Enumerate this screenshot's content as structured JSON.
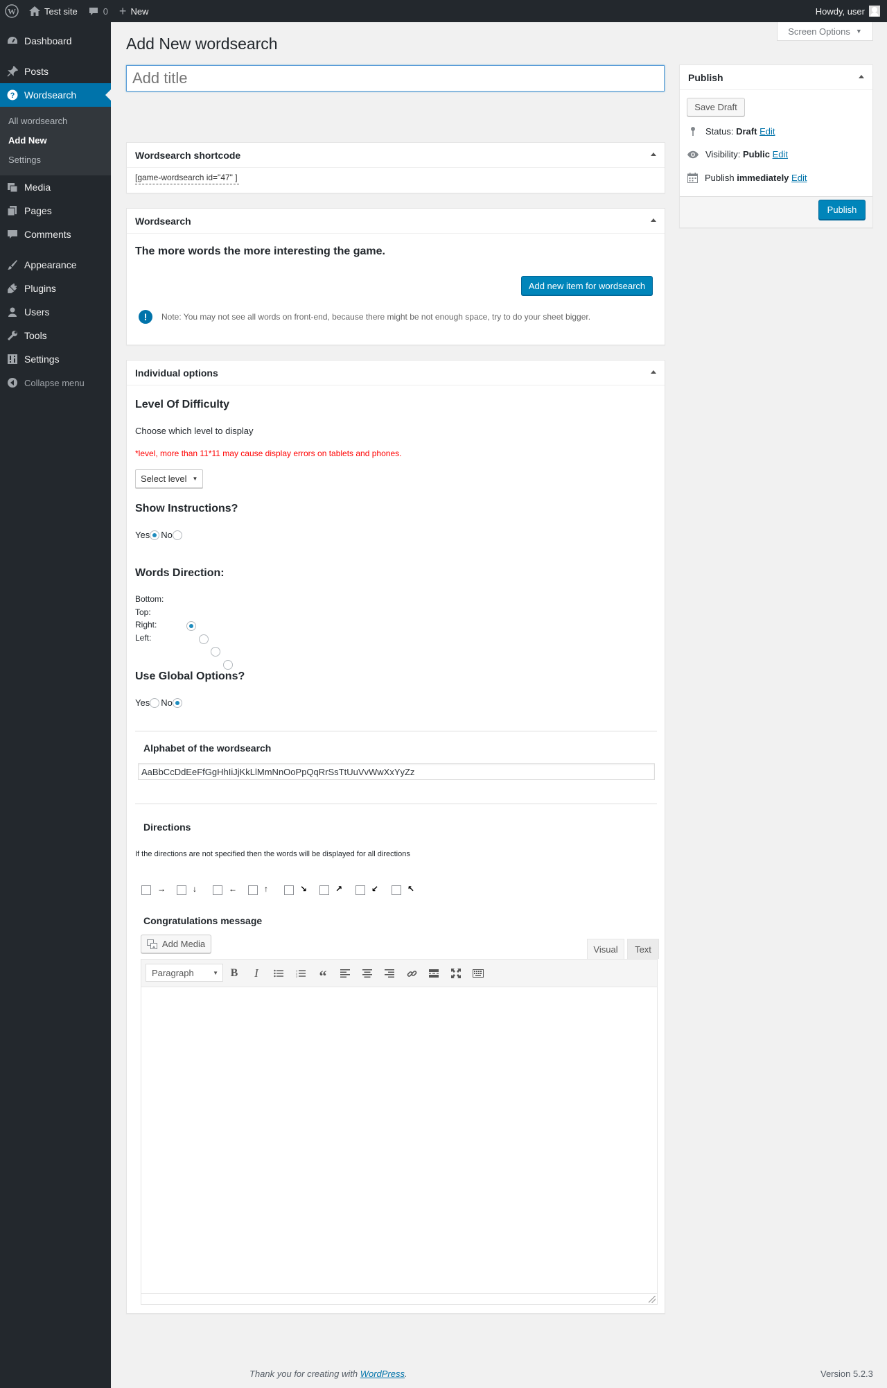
{
  "adminbar": {
    "site_name": "Test site",
    "comments_count": "0",
    "new_label": "New",
    "howdy": "Howdy, user"
  },
  "sidebar": {
    "items_top": [
      {
        "label": "Dashboard",
        "icon": "dashboard-icon"
      },
      {
        "label": "Posts",
        "icon": "pin-icon"
      }
    ],
    "current": {
      "label": "Wordsearch",
      "icon": "question-icon"
    },
    "submenu": [
      "All wordsearch",
      "Add New",
      "Settings"
    ],
    "items_bottom": [
      {
        "label": "Media",
        "icon": "media-icon"
      },
      {
        "label": "Pages",
        "icon": "pages-icon"
      },
      {
        "label": "Comments",
        "icon": "comment-icon"
      },
      {
        "label": "Appearance",
        "icon": "brush-icon"
      },
      {
        "label": "Plugins",
        "icon": "plugin-icon"
      },
      {
        "label": "Users",
        "icon": "user-icon"
      },
      {
        "label": "Tools",
        "icon": "wrench-icon"
      },
      {
        "label": "Settings",
        "icon": "settings-icon"
      }
    ],
    "collapse": "Collapse menu"
  },
  "screen_options": "Screen Options",
  "page_title": "Add New wordsearch",
  "title_placeholder": "Add title",
  "shortcode_box": {
    "title": "Wordsearch shortcode",
    "shortcode": "[game-wordsearch id=\"47\" ]"
  },
  "wordsearch_box": {
    "title": "Wordsearch",
    "heading": "The more words the more interesting the game.",
    "add_button": "Add new item for wordsearch",
    "note": "Note: You may not see all words on front-end, because there might be not enough space, try to do your sheet bigger."
  },
  "options_box": {
    "title": "Individual options",
    "difficulty_heading": "Level Of Difficulty",
    "difficulty_desc": "Choose which level to display",
    "difficulty_warning": "*level, more than 11*11 may cause display errors on tablets and phones.",
    "level_select": "Select level",
    "instructions_heading": "Show Instructions?",
    "yes": "Yes",
    "no": "No",
    "direction_heading": "Words Direction:",
    "directions": [
      "Bottom:",
      "Top:",
      "Right:",
      "Left:"
    ],
    "global_heading": "Use Global Options?",
    "alphabet_heading": "Alphabet of the wordsearch",
    "alphabet_value": "AaBbCcDdEeFfGgHhIiJjKkLlMmNnOoPpQqRrSsTtUuVvWwXxYyZz",
    "directions_heading": "Directions",
    "directions_desc": "If the directions are not specified then the words will be displayed for all directions",
    "direction_arrows": [
      "→",
      "↓",
      "←",
      "↑",
      "↘",
      "↗",
      "↙",
      "↖"
    ],
    "congrats_heading": "Congratulations message",
    "add_media": "Add Media",
    "tab_visual": "Visual",
    "tab_text": "Text",
    "format_select": "Paragraph"
  },
  "publish_box": {
    "title": "Publish",
    "save_draft": "Save Draft",
    "status_label": "Status:",
    "status_value": "Draft",
    "visibility_label": "Visibility:",
    "visibility_value": "Public",
    "publish_label": "Publish",
    "publish_value": "immediately",
    "edit": "Edit",
    "publish_button": "Publish"
  },
  "footer": {
    "thanks": "Thank you for creating with",
    "wp_link": "WordPress",
    "version": "Version 5.2.3"
  }
}
